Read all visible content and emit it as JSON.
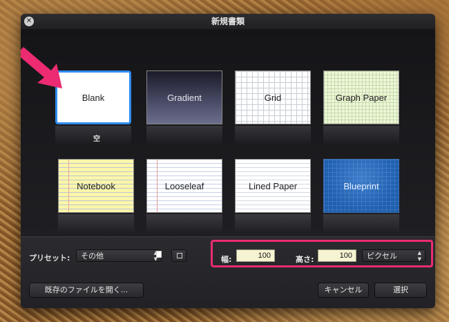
{
  "window": {
    "title": "新規書類",
    "close_glyph": "✕"
  },
  "templates": [
    {
      "label": "Blank",
      "selected": true
    },
    {
      "label": "Gradient"
    },
    {
      "label": "Grid"
    },
    {
      "label": "Graph Paper"
    },
    {
      "label": "Notebook"
    },
    {
      "label": "Looseleaf"
    },
    {
      "label": "Lined Paper"
    },
    {
      "label": "Blueprint"
    }
  ],
  "selected_caption": "空",
  "preset": {
    "label": "プリセット:",
    "value": "その他",
    "icon": "document-icon"
  },
  "size": {
    "width_label": "幅:",
    "width_value": "100",
    "height_label": "高さ:",
    "height_value": "100",
    "unit_value": "ピクセル"
  },
  "buttons": {
    "open": "既存のファイルを開く...",
    "cancel": "キャンセル",
    "choose": "選択"
  },
  "colors": {
    "selection": "#2f8bf0",
    "highlight": "#ec2b72",
    "arrow": "#ec2b72"
  }
}
